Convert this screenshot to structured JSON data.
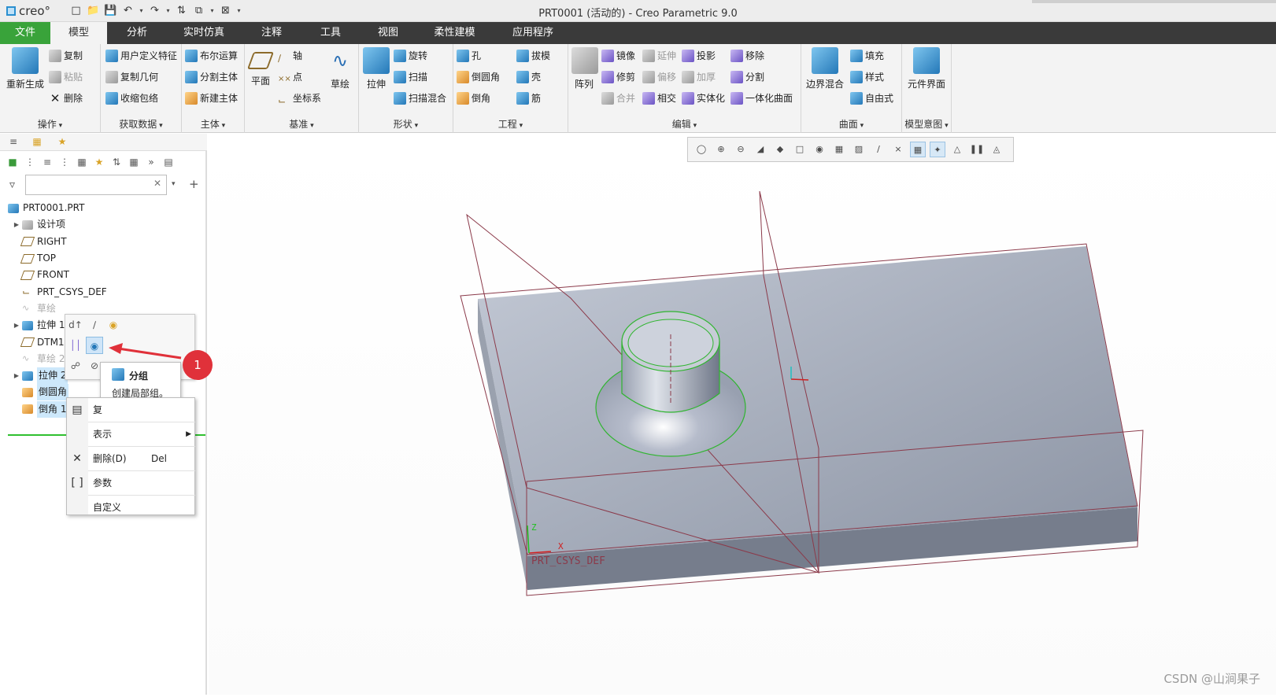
{
  "window": {
    "logo": "creo°",
    "title": "PRT0001 (活动的) - Creo Parametric 9.0"
  },
  "tabs": {
    "file": "文件",
    "model": "模型",
    "analysis": "分析",
    "simulation": "实时仿真",
    "annotate": "注释",
    "tools": "工具",
    "view": "视图",
    "flexible": "柔性建模",
    "apps": "应用程序"
  },
  "ribbon": {
    "operations": {
      "label": "操作",
      "regenerate": "重新生成",
      "copy": "复制",
      "paste": "粘贴",
      "delete": "删除"
    },
    "getdata": {
      "label": "获取数据",
      "udf": "用户定义特征",
      "copy_geom": "复制几何",
      "shrinkwrap": "收缩包络"
    },
    "body": {
      "label": "主体",
      "boolean": "布尔运算",
      "split_body": "分割主体",
      "new_body": "新建主体"
    },
    "datum": {
      "label": "基准",
      "plane": "平面",
      "axis": "轴",
      "point": "点",
      "csys": "坐标系",
      "sketch": "草绘"
    },
    "shapes": {
      "label": "形状",
      "extrude": "拉伸",
      "revolve": "旋转",
      "sweep": "扫描",
      "swept_blend": "扫描混合"
    },
    "engineering": {
      "label": "工程",
      "hole": "孔",
      "round": "倒圆角",
      "chamfer": "倒角",
      "draft": "拔模",
      "shell": "壳",
      "rib": "筋"
    },
    "editing": {
      "label": "编辑",
      "pattern": "阵列",
      "mirror": "镜像",
      "trim": "修剪",
      "merge": "合并",
      "extend": "延伸",
      "offset": "偏移",
      "intersect": "相交",
      "project": "投影",
      "thicken": "加厚",
      "solidify": "实体化",
      "remove": "移除",
      "split": "分割",
      "unify": "一体化曲面"
    },
    "surfaces": {
      "label": "曲面",
      "boundary_blend": "边界混合",
      "fill": "填充",
      "style": "样式",
      "freestyle": "自由式"
    },
    "intent": {
      "label": "模型意图",
      "component_interface": "元件界面"
    }
  },
  "tree": {
    "root": "PRT0001.PRT",
    "items": [
      "设计项",
      "RIGHT",
      "TOP",
      "FRONT",
      "PRT_CSYS_DEF",
      "草绘",
      "拉伸 1",
      "DTM1",
      "草绘 2",
      "拉伸 2",
      "倒圆角",
      "倒角 1"
    ]
  },
  "tooltip": {
    "title": "分组",
    "desc": "创建局部组。"
  },
  "context_menu": {
    "copy": "复",
    "display": "表示",
    "delete": "删除(D)",
    "delete_shortcut": "Del",
    "params": "参数",
    "customize": "自定义"
  },
  "callout": "1",
  "viewport": {
    "csys_label": "PRT_CSYS_DEF",
    "axis_z": "Z",
    "axis_x": "X"
  },
  "watermark": "CSDN @山涧果子"
}
